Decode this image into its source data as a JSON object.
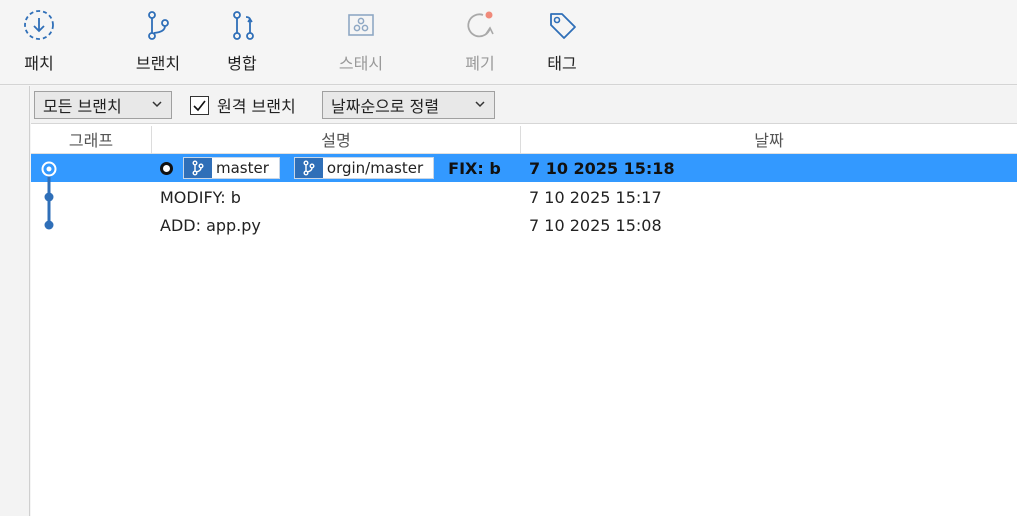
{
  "toolbar": {
    "patch": "패치",
    "branch": "브랜치",
    "merge": "병합",
    "stash": "스태시",
    "discard": "폐기",
    "tag": "태그"
  },
  "filters": {
    "branch_scope": "모든 브랜치",
    "remote_branches_label": "원격 브랜치",
    "remote_branches_checked": true,
    "sort_order": "날짜순으로 정렬"
  },
  "columns": {
    "graph": "그래프",
    "description": "설명",
    "date": "날짜"
  },
  "commits": [
    {
      "branches": [
        "master",
        "orgin/master"
      ],
      "message": "FIX: b",
      "date": "7 10 2025 15:18",
      "selected": true
    },
    {
      "message": "MODIFY: b",
      "date": "7 10 2025 15:17"
    },
    {
      "message": "ADD: app.py",
      "date": "7 10 2025 15:08"
    }
  ],
  "colors": {
    "accent": "#2f6fb8",
    "selection": "#3399ff",
    "discard_dot": "#f08a7a"
  }
}
